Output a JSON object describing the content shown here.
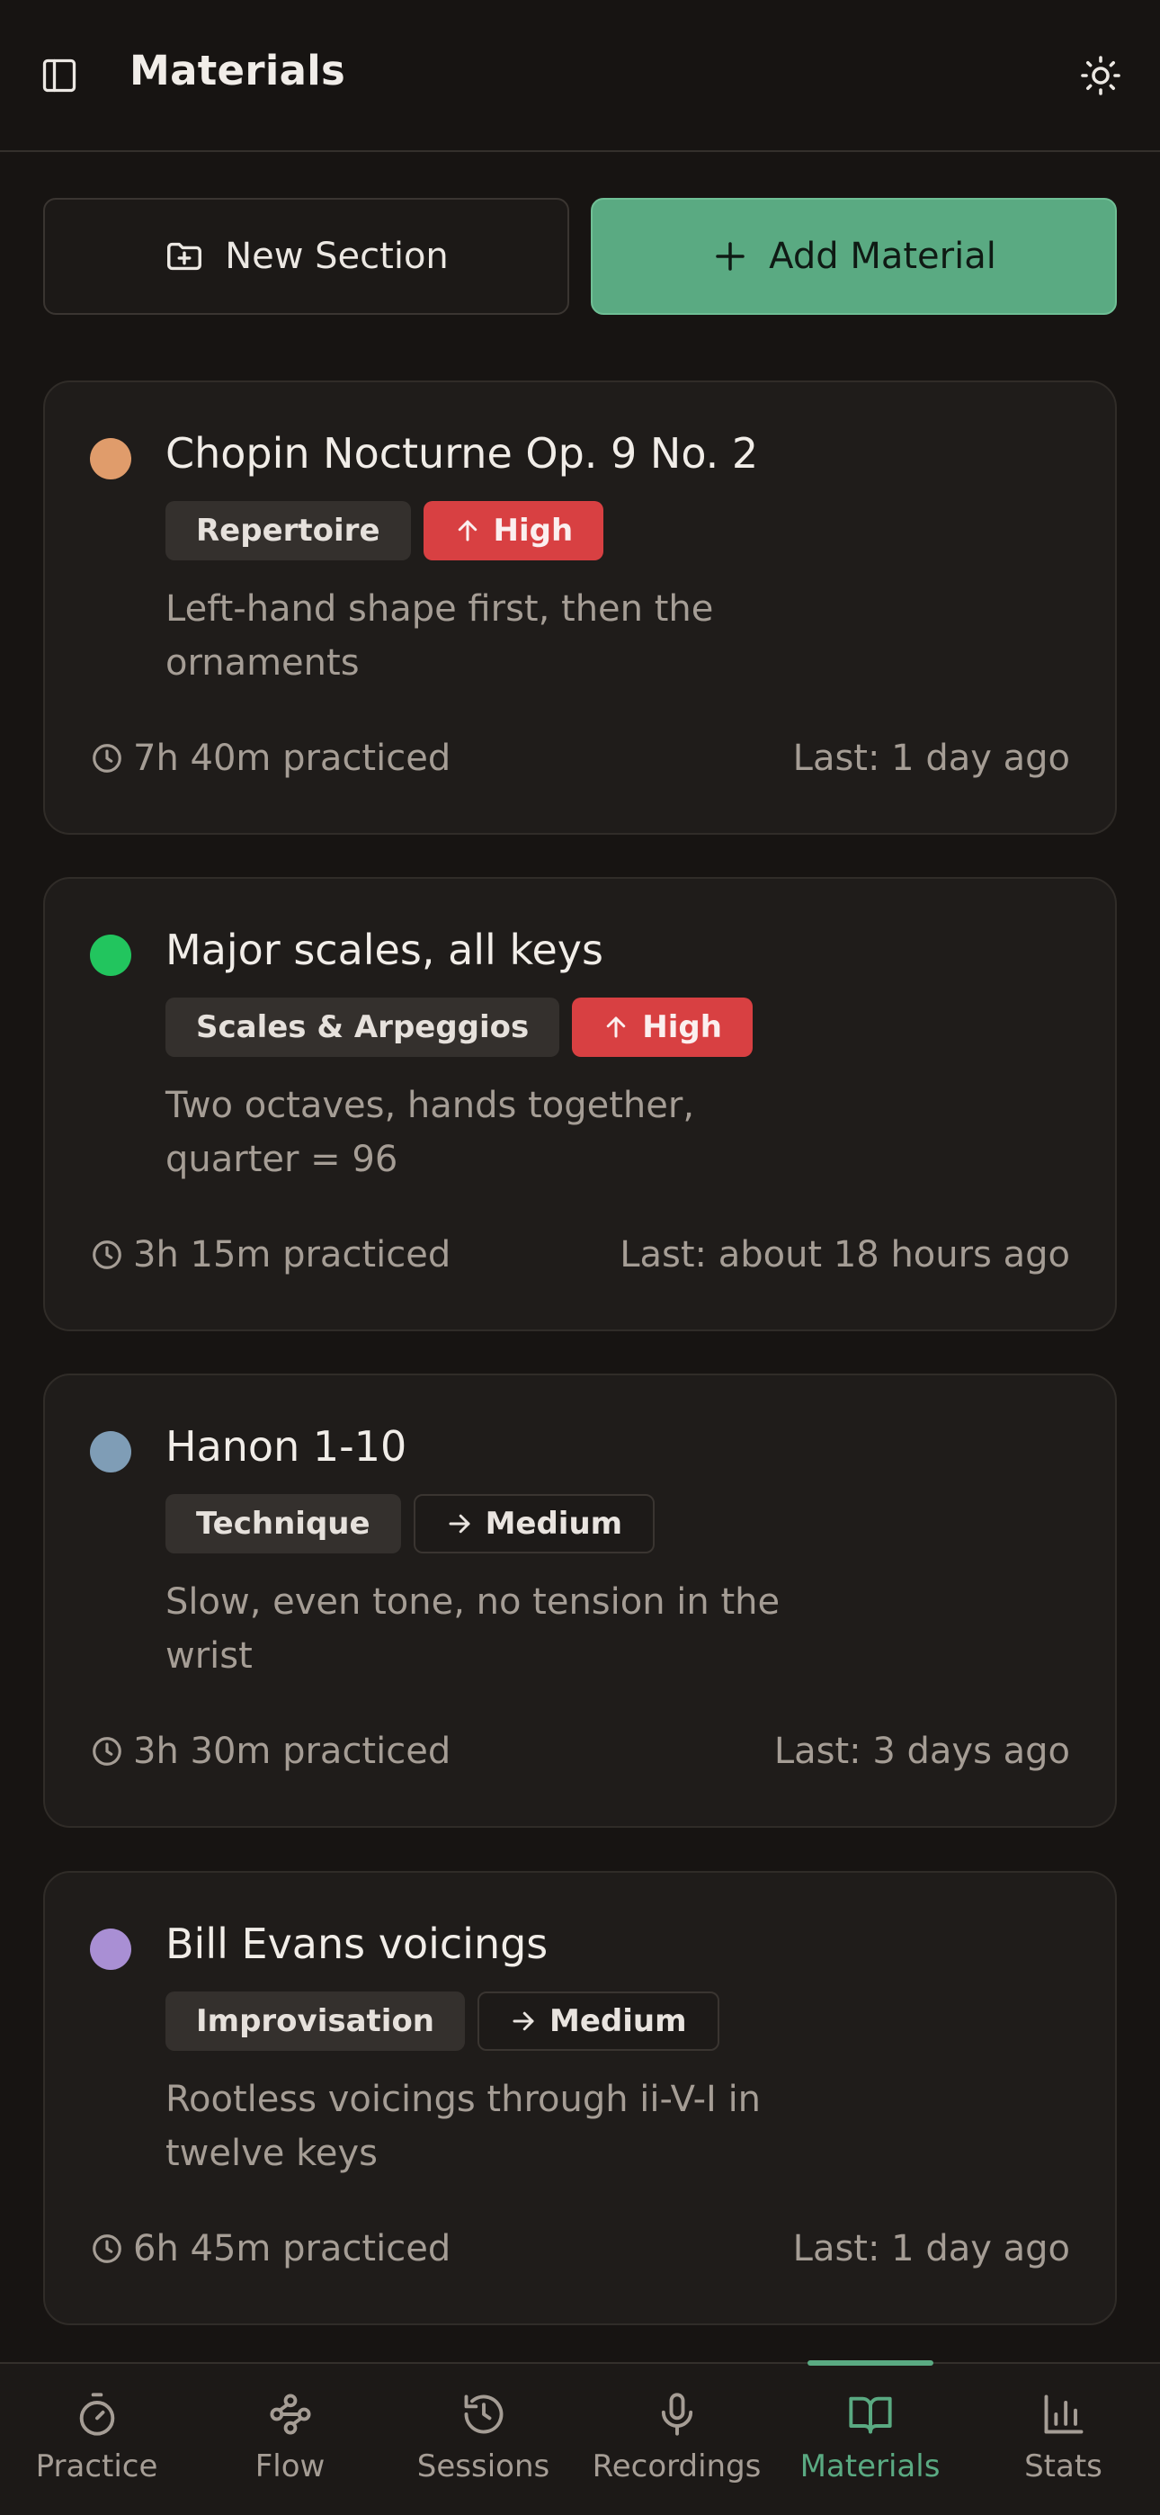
{
  "header": {
    "title": "Materials"
  },
  "actions": {
    "new_section": "New Section",
    "add_material": "Add Material"
  },
  "materials": [
    {
      "name": "Chopin Nocturne Op. 9 No. 2",
      "category": "Repertoire",
      "priority": "High",
      "description": "Left-hand shape first, then the ornaments",
      "practiced": "7h 40m practiced",
      "last": "Last: 1 day ago",
      "color": "#e09c6b"
    },
    {
      "name": "Major scales, all keys",
      "category": "Scales & Arpeggios",
      "priority": "High",
      "description": "Two octaves, hands together, quarter = 96",
      "practiced": "3h 15m practiced",
      "last": "Last: about 18 hours ago",
      "color": "#22c55e"
    },
    {
      "name": "Hanon 1-10",
      "category": "Technique",
      "priority": "Medium",
      "description": "Slow, even tone, no tension in the wrist",
      "practiced": "3h 30m practiced",
      "last": "Last: 3 days ago",
      "color": "#7f9db6"
    },
    {
      "name": "Bill Evans voicings",
      "category": "Improvisation",
      "priority": "Medium",
      "description": "Rootless voicings through ii-V-I in twelve keys",
      "practiced": "6h 45m practiced",
      "last": "Last: 1 day ago",
      "color": "#a98fd4"
    }
  ],
  "nav": {
    "practice": "Practice",
    "flow": "Flow",
    "sessions": "Sessions",
    "recordings": "Recordings",
    "materials": "Materials",
    "stats": "Stats",
    "active": "materials"
  },
  "colors": {
    "accent": "#5aaa82",
    "priority_high": "#d84042",
    "background": "#171412",
    "card": "#1f1c1a"
  },
  "icons": {
    "sidebar_toggle": "panel-left-icon",
    "theme_toggle": "sun-icon",
    "new_section": "folder-plus-icon",
    "add_material": "plus-icon",
    "priority_high": "arrow-up-icon",
    "priority_medium": "arrow-right-icon",
    "practiced": "clock-icon",
    "nav": [
      "timer-icon",
      "workflow-icon",
      "history-icon",
      "mic-icon",
      "book-open-icon",
      "bar-chart-icon"
    ]
  }
}
